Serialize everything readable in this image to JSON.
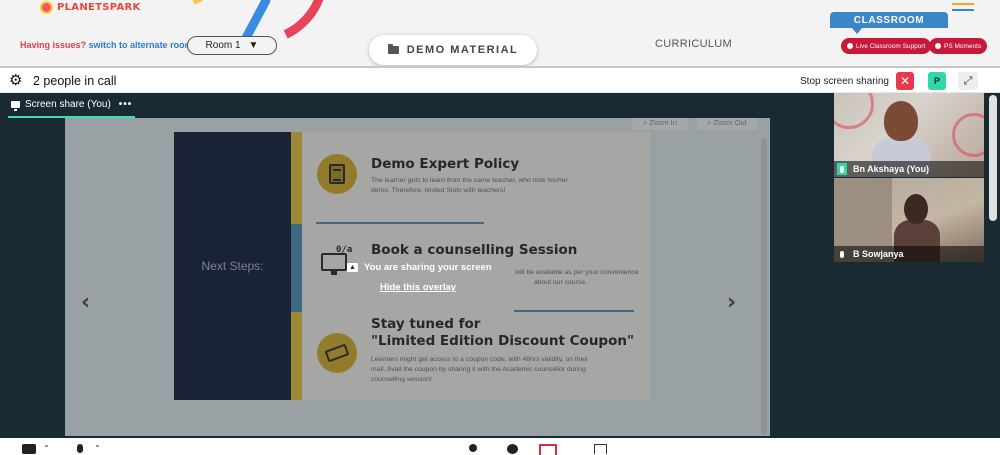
{
  "header": {
    "logo_text": "PLANETSPARK",
    "issues_text": "Having issues?",
    "alternate_room_link": "switch to alternate room",
    "room_select_value": "Room 1",
    "demo_material_label": "DEMO MATERIAL",
    "curriculum_label": "CURRICULUM",
    "classroom_tab_label": "CLASSROOM",
    "live_support_label": "Live Classroom Support",
    "ps_moments_label": "PS Moments"
  },
  "callbar": {
    "people_count_text": "2 people in call",
    "stop_share_label": "Stop screen sharing",
    "stop_icon": "✕",
    "avatar_initial": "P",
    "expand_icon": "⤢"
  },
  "stage": {
    "share_tab_label": "Screen share (You)",
    "share_tab_more": "•••",
    "zoom_in_label": "Zoom In",
    "zoom_out_label": "Zoom Out",
    "overlay_message": "You are sharing your screen",
    "hide_overlay_link": "Hide this overlay",
    "prev_arrow": "‹",
    "next_arrow": "›"
  },
  "slide": {
    "next_steps": "Next Steps:",
    "sections": [
      {
        "title": "Demo Expert Policy",
        "body_lines": [
          "The learner gets to learn from the same teacher, who took his/her",
          "demo. Therefore, limited Slots with teachers!"
        ]
      },
      {
        "title": "Book a counselling Session",
        "body_lines": [
          "will be available as per your convenience",
          "about our course."
        ]
      },
      {
        "title_lines": [
          "Stay tuned for",
          "\"Limited Edition Discount Coupon\""
        ],
        "body_lines": [
          "Learners might get access to a coupon code, with 48hrs validity, on their",
          "mail. Avail the coupon by sharing it with the Academic counsellor during",
          "counselling session!"
        ]
      }
    ]
  },
  "participants": [
    {
      "name": "Bn Akshaya (You)",
      "mic_active": true
    },
    {
      "name": "B Sowjanya",
      "mic_active": false
    }
  ],
  "toolbar": {
    "caret": "⌄"
  },
  "colors": {
    "brand_red": "#e03c4b",
    "link_blue": "#2c7bd4",
    "classroom_blue": "#3a86c8",
    "stage_bg": "#1a2a32",
    "accent_green": "#3ddcb1",
    "stop_red": "#e8394c",
    "pill_red": "#c8193c"
  }
}
